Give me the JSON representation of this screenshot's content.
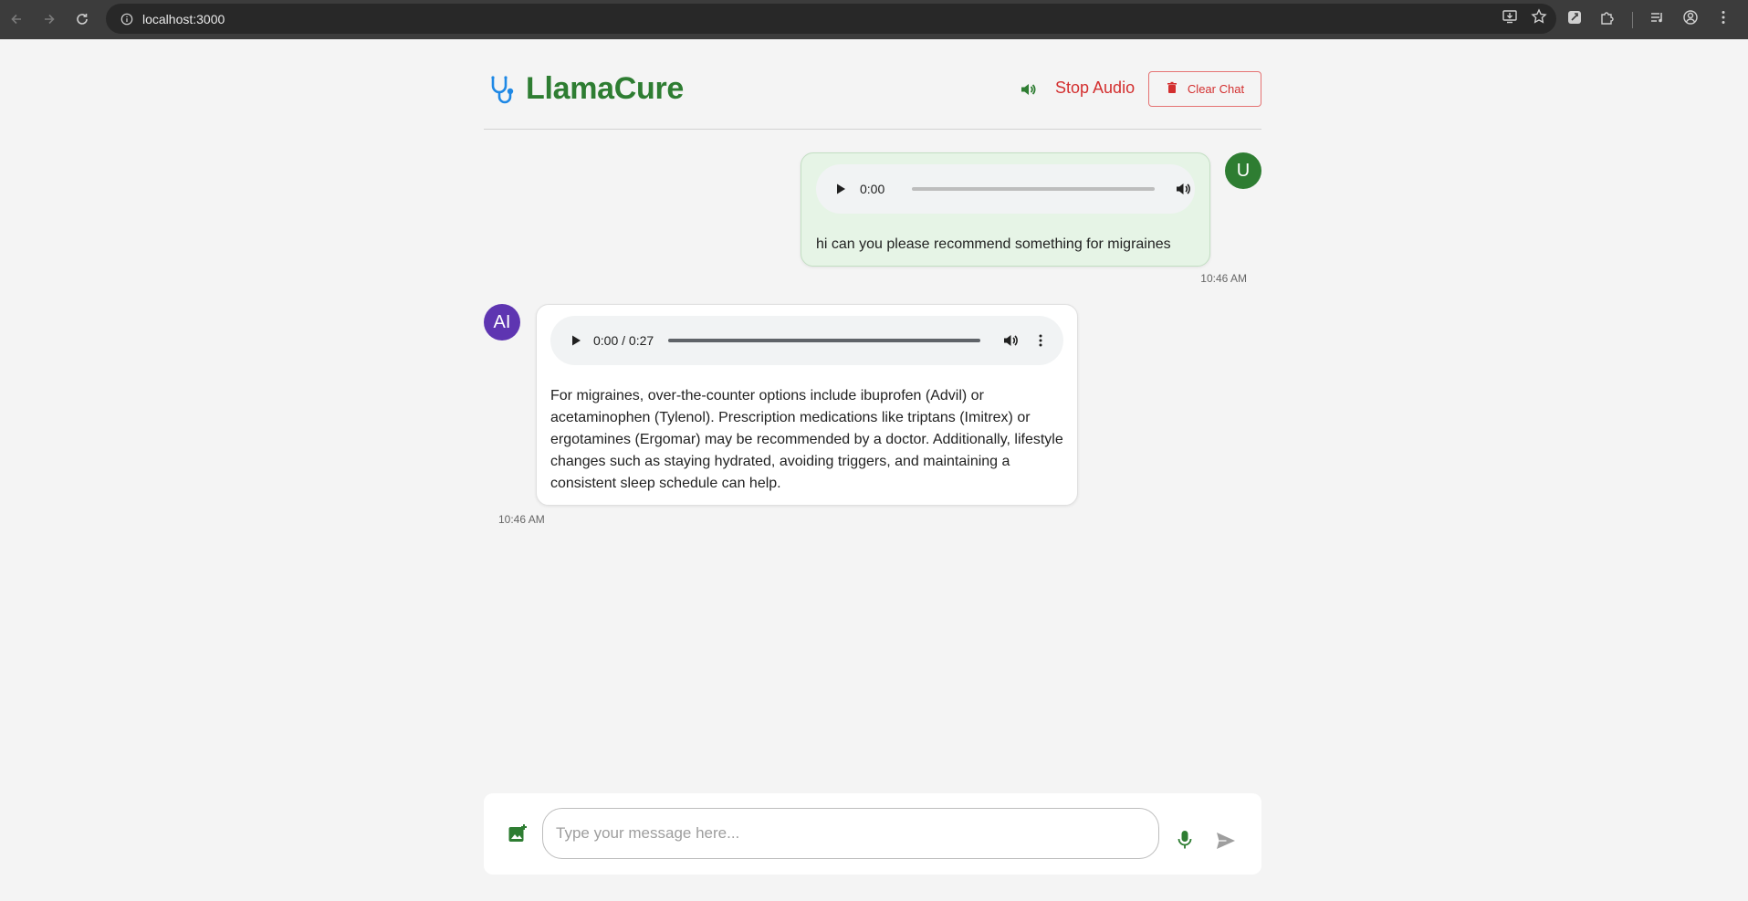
{
  "browser": {
    "url": "localhost:3000"
  },
  "app": {
    "title": "LlamaCure",
    "stop_audio_label": "Stop Audio",
    "clear_chat_label": "Clear Chat",
    "brand_color": "#2e7d32",
    "danger_color": "#d32f2f"
  },
  "messages": [
    {
      "sender": "user",
      "avatar": "U",
      "audio_time": "0:00",
      "text": "hi can you please recommend something for migraines",
      "timestamp": "10:46 AM"
    },
    {
      "sender": "ai",
      "avatar": "AI",
      "audio_time": "0:00 / 0:27",
      "text": "For migraines, over-the-counter options include ibuprofen (Advil) or acetaminophen (Tylenol). Prescription medications like triptans (Imitrex) or ergotamines (Ergomar) may be recommended by a doctor. Additionally, lifestyle changes such as staying hydrated, avoiding triggers, and maintaining a consistent sleep schedule can help.",
      "timestamp": "10:46 AM"
    }
  ],
  "composer": {
    "placeholder": "Type your message here...",
    "value": ""
  }
}
